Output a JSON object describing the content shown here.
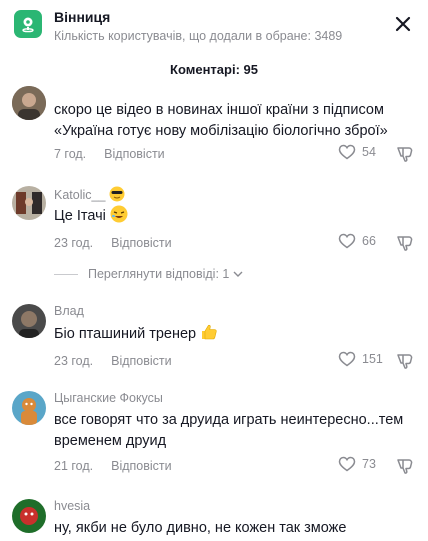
{
  "header": {
    "location_title": "Вінниця",
    "location_subtitle": "Кількість користувачів, що додали в обране: 3489",
    "location_icon": "map-pin-icon",
    "close_icon": "close-icon"
  },
  "comments_header": "Коментарі: 95",
  "reply_label": "Відповісти",
  "comments": [
    {
      "username": "",
      "text": "скоро це відео в новинах іншої країни з підписом «Україна готує нову мобілізацію біологічно зброї»",
      "time": "7 год.",
      "likes": "54"
    },
    {
      "username": "Katolic__",
      "username_emoji": "cool-face-emoji",
      "text": "Це Ітачі",
      "text_emoji": "laughing-face-emoji",
      "time": "23 год.",
      "likes": "66"
    },
    {
      "username": "Влад",
      "text": "Біо пташиний тренер",
      "text_emoji": "thumbs-up-emoji",
      "time": "23 год.",
      "likes": "151"
    },
    {
      "username": "Цыганские Фокусы",
      "text": "все говорят что за друида играть неинтересно...тем временем друид",
      "time": "21 год.",
      "likes": "73"
    },
    {
      "username": "hvesia",
      "text": "ну, якби не було дивно, не кожен так зможе",
      "time": "",
      "likes": ""
    }
  ],
  "view_replies": "Переглянути відповіді: 1",
  "colors": {
    "accent": "#2bb673",
    "text": "#161823",
    "muted": "#8a8b91"
  }
}
